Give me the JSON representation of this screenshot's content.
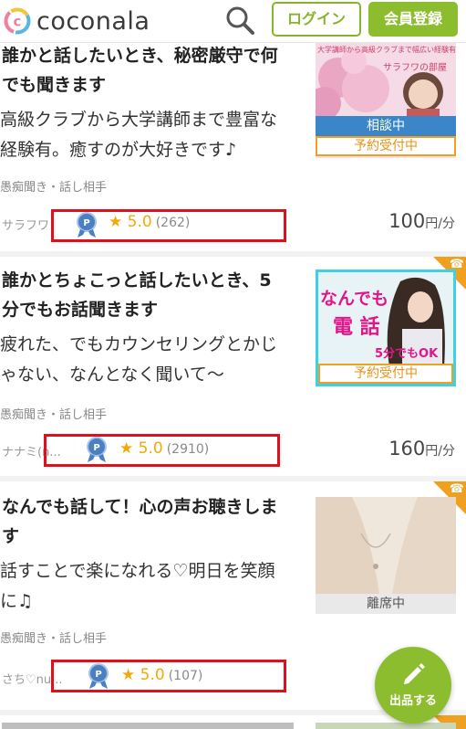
{
  "header": {
    "logo_text": "coconala",
    "login_label": "ログイン",
    "register_label": "会員登録"
  },
  "items": [
    {
      "title": "誰かと話したいとき、秘密厳守で何でも聞きます",
      "title_line1": "誰かと話したいとき、秘密厳守で何",
      "title_line2": "でも聞きます",
      "desc_line1": "高級クラブから大学講師まで豊富な",
      "desc_line2": "経験有。癒すのが大好きです♪",
      "category": "愚痴聞き・話し相手",
      "seller": "サラフワ",
      "score": "5.0",
      "count": "(262)",
      "price": "100",
      "price_unit": "円/分",
      "thumb_caption": "大学講師から高級クラブまで幅広い経験有",
      "thumb_name": "サラフワの部屋",
      "status_top": "相談中",
      "status_bottom": "予約受付中"
    },
    {
      "title_line1": "誰かとちょこっと話したいとき、5",
      "title_line2": "分でもお話聞きます",
      "desc_line1": "疲れた、でもカウンセリングとかじ",
      "desc_line2": "ゃない、なんとなく聞いて〜",
      "category": "愚痴聞き・話し相手",
      "seller": "ナナミ(n...",
      "score": "5.0",
      "count": "(2910)",
      "price": "160",
      "price_unit": "円/分",
      "thumb_text1": "なんでも",
      "thumb_text2": "電 話",
      "thumb_text3": "5分でもOK",
      "status_bottom": "予約受付中"
    },
    {
      "title_line1": "なんでも話して！心の声お聴きしま",
      "title_line2": "す",
      "desc_line1": "話すことで楽になれる♡明日を笑顔",
      "desc_line2": "に♫",
      "category": "愚痴聞き・話し相手",
      "seller": "さち♡nu...",
      "score": "5.0",
      "count": "(107)",
      "status_bottom": "離席中"
    }
  ],
  "fab": {
    "label": "出品する"
  },
  "colors": {
    "brand_green": "#8cbd2e",
    "star": "#f5a80a",
    "highlight_red": "#e0101a",
    "corner_orange": "#f0a020"
  }
}
